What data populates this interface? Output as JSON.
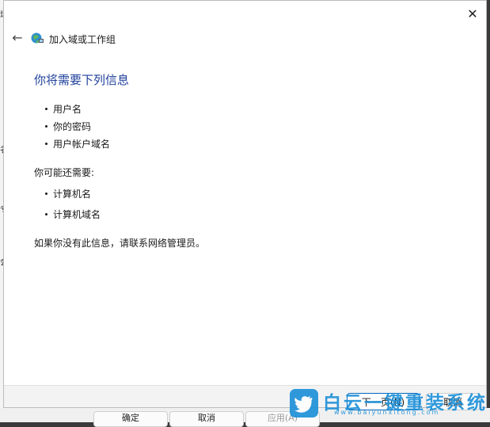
{
  "window": {
    "title": "加入域或工作组",
    "close_label": "✕",
    "back_label": "←"
  },
  "content": {
    "heading": "你将需要下列信息",
    "required_items": [
      "用户名",
      "你的密码",
      "用户帐户域名"
    ],
    "optional_heading": "你可能还需要:",
    "optional_items": [
      "计算机名",
      "计算机域名"
    ],
    "note": "如果你没有此信息，请联系网络管理员。"
  },
  "buttons": {
    "next": "下一页(N)",
    "cancel": "取消"
  },
  "background": {
    "left_glyphs": [
      "域",
      "名",
      "专",
      "会"
    ],
    "buttons": [
      "确定",
      "取消",
      "应用(A)"
    ]
  },
  "watermark": {
    "text": "白云一键重装系统",
    "sub": "www.baiyunxitong.com"
  },
  "colors": {
    "heading": "#1f3f9b",
    "accent": "#0067c0",
    "watermark": "#1a8fd8"
  }
}
